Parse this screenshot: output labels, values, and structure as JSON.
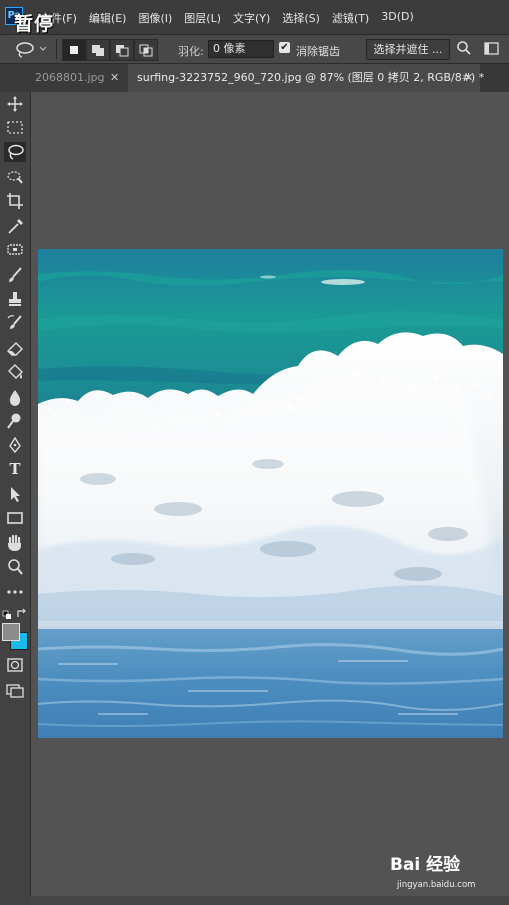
{
  "app": {
    "logo_text": "Ps",
    "pause_label": "暂停",
    "colors": {
      "ui_dark": "#3c3c3c",
      "workspace": "#535353",
      "accent_blue": "#1fb8f0"
    }
  },
  "menu": {
    "items": [
      "文件(F)",
      "编辑(E)",
      "图像(I)",
      "图层(L)",
      "文字(Y)",
      "选择(S)",
      "滤镜(T)",
      "3D(D)"
    ]
  },
  "options": {
    "tool_icon": "lasso-icon",
    "feather_label": "羽化:",
    "feather_value": "0 像素",
    "antialias_label": "消除锯齿",
    "antialias_checked": true,
    "select_mask_label": "选择并遮住 ..."
  },
  "tabs": [
    {
      "label": "2068801.jpg",
      "active": false
    },
    {
      "label": "surfing-3223752_960_720.jpg @ 87% (图层 0 拷贝 2, RGB/8#) *",
      "active": true
    }
  ],
  "toolbar": {
    "tools": [
      "move-icon",
      "marquee-icon",
      "lasso-icon",
      "quick-select-icon",
      "crop-icon",
      "eyedropper-icon",
      "healing-brush-icon",
      "brush-icon",
      "clone-stamp-icon",
      "history-brush-icon",
      "eraser-icon",
      "paint-bucket-icon",
      "blur-icon",
      "dodge-icon",
      "pen-icon",
      "type-icon",
      "path-select-icon",
      "rectangle-icon",
      "hand-icon",
      "zoom-icon",
      "more-tools-icon"
    ],
    "type_glyph": "T",
    "foreground_color": "#8c8c8c",
    "background_color": "#19b9ee"
  },
  "canvas": {
    "subject": "ocean-wave-photo"
  },
  "watermark": {
    "logo": "Bai 经验",
    "url": "jingyan.baidu.com"
  }
}
